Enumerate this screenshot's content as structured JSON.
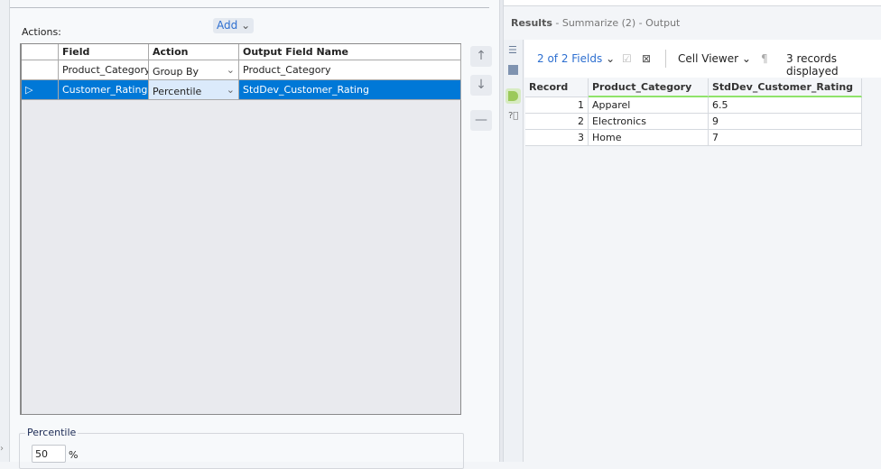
{
  "config": {
    "add_label": "Add",
    "actions_label": "Actions:",
    "columns": [
      "Field",
      "Action",
      "Output Field Name"
    ],
    "rows": [
      {
        "field": "Product_Category",
        "action": "Group By",
        "output": "Product_Category",
        "selected": false
      },
      {
        "field": "Customer_Rating",
        "action": "Percentile",
        "output": "StdDev_Customer_Rating",
        "selected": true
      }
    ],
    "percentile": {
      "legend": "Percentile",
      "value": "50",
      "unit": "%"
    }
  },
  "results": {
    "title": "Results",
    "subtitle": "- Summarize (2) - Output",
    "fields_label": "2 of 2 Fields",
    "cell_viewer": "Cell Viewer",
    "records_displayed": "3 records displayed",
    "columns": [
      "Record",
      "Product_Category",
      "StdDev_Customer_Rating"
    ],
    "rows": [
      [
        "1",
        "Apparel",
        "6.5"
      ],
      [
        "2",
        "Electronics",
        "9"
      ],
      [
        "3",
        "Home",
        "7"
      ]
    ]
  },
  "colors": {
    "accent": "#0078d7",
    "link": "#2d6fd0",
    "field_ok": "#8fe36a"
  }
}
